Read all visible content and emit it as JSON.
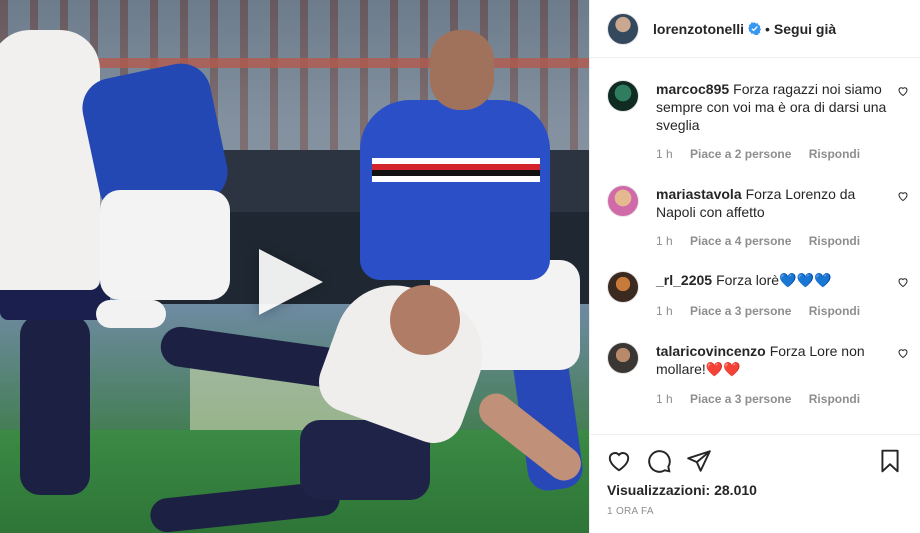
{
  "post": {
    "owner": {
      "username": "lorenzotonelli",
      "verified": true,
      "follow_status": "Segui già",
      "separator": "•"
    },
    "media": {
      "type": "video",
      "play_icon": "play-icon"
    }
  },
  "comments": [
    {
      "username": "marcoc895",
      "text": "Forza ragazzi noi siamo sempre con voi ma è ora di darsi una sveglia",
      "time": "1 h",
      "likes": "Piace a 2 persone",
      "reply": "Rispondi"
    },
    {
      "username": "mariastavola",
      "text": "Forza Lorenzo da Napoli con affetto",
      "time": "1 h",
      "likes": "Piace a 4 persone",
      "reply": "Rispondi"
    },
    {
      "username": "_rl_2205",
      "text": "Forza lorè💙💙💙",
      "time": "1 h",
      "likes": "Piace a 3 persone",
      "reply": "Rispondi"
    },
    {
      "username": "talaricovincenzo",
      "text": "Forza Lore non mollare!❤️❤️",
      "time": "1 h",
      "likes": "Piace a 3 persone",
      "reply": "Rispondi"
    }
  ],
  "actions": {
    "icons": [
      "heart-icon",
      "comment-icon",
      "share-icon",
      "bookmark-icon"
    ],
    "views_label": "Visualizzazioni:",
    "views_count": "28.010",
    "posted_ago": "1 ORA FA"
  },
  "colors": {
    "text": "#262626",
    "muted": "#8e8e8e",
    "divider": "#efefef",
    "verified_blue": "#3897f0"
  }
}
